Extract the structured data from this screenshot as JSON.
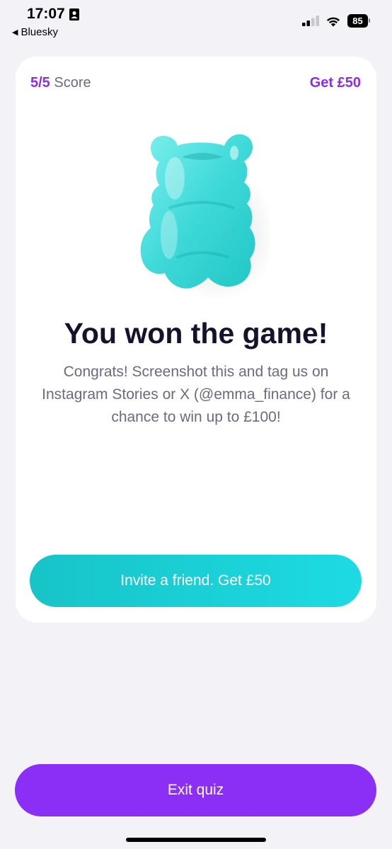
{
  "status_bar": {
    "time": "17:07",
    "back_app": "Bluesky",
    "battery": "85",
    "icons": [
      "contact-card-icon",
      "signal-icon",
      "wifi-icon",
      "battery-icon"
    ]
  },
  "card": {
    "score_value": "5/5",
    "score_label": "Score",
    "reward_link": "Get £50",
    "illustration": "gummy-bear-icon",
    "headline": "You won the game!",
    "message": "Congrats! Screenshot this and tag us on Instagram Stories or X (@emma_finance) for a chance to win up to £100!",
    "invite_button": "Invite a friend. Get £50"
  },
  "footer": {
    "exit_button": "Exit quiz"
  },
  "colors": {
    "accent_purple": "#8b2ff7",
    "accent_teal": "#1ddbe3",
    "background": "#f2f2f7"
  }
}
